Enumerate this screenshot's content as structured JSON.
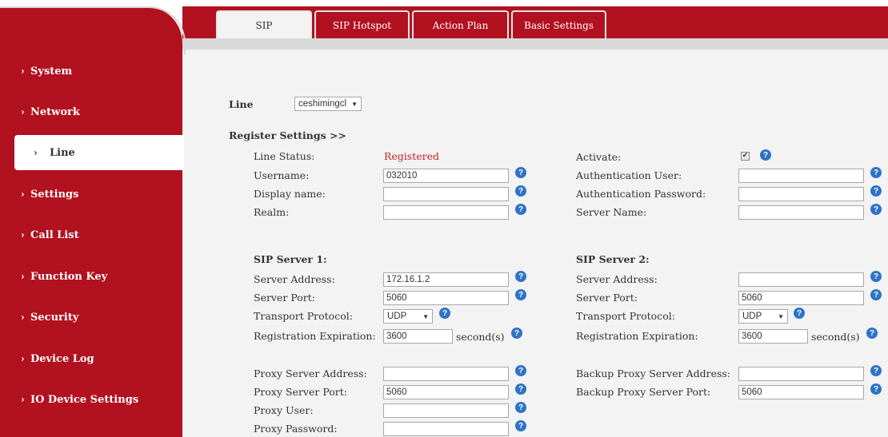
{
  "sidebar": {
    "items": [
      {
        "label": "System"
      },
      {
        "label": "Network"
      },
      {
        "label": "Line"
      },
      {
        "label": "Settings"
      },
      {
        "label": "Call List"
      },
      {
        "label": "Function Key"
      },
      {
        "label": "Security"
      },
      {
        "label": "Device Log"
      },
      {
        "label": "IO Device Settings"
      }
    ],
    "chevron": "›"
  },
  "tabs": [
    {
      "label": "SIP"
    },
    {
      "label": "SIP Hotspot"
    },
    {
      "label": "Action Plan"
    },
    {
      "label": "Basic Settings"
    }
  ],
  "line": {
    "label": "Line",
    "selected": "ceshimingcl"
  },
  "register_settings": {
    "title": "Register Settings >>"
  },
  "fields": {
    "line_status": {
      "label": "Line Status:",
      "value": "Registered"
    },
    "activate": {
      "label": "Activate:",
      "checked": true
    },
    "username": {
      "label": "Username:",
      "value": "032010"
    },
    "auth_user": {
      "label": "Authentication User:",
      "value": ""
    },
    "display_name": {
      "label": "Display name:",
      "value": ""
    },
    "auth_password": {
      "label": "Authentication Password:",
      "value": ""
    },
    "realm": {
      "label": "Realm:",
      "value": ""
    },
    "server_name": {
      "label": "Server Name:",
      "value": ""
    }
  },
  "sip_server_1": {
    "title": "SIP Server 1:",
    "address": {
      "label": "Server Address:",
      "value": "172.16.1.2"
    },
    "port": {
      "label": "Server Port:",
      "value": "5060"
    },
    "transport": {
      "label": "Transport Protocol:",
      "value": "UDP"
    },
    "expiration": {
      "label": "Registration Expiration:",
      "value": "3600",
      "unit": "second(s)"
    }
  },
  "sip_server_2": {
    "title": "SIP Server 2:",
    "address": {
      "label": "Server Address:",
      "value": ""
    },
    "port": {
      "label": "Server Port:",
      "value": "5060"
    },
    "transport": {
      "label": "Transport Protocol:",
      "value": "UDP"
    },
    "expiration": {
      "label": "Registration Expiration:",
      "value": "3600",
      "unit": "second(s)"
    }
  },
  "proxy": {
    "address": {
      "label": "Proxy Server Address:",
      "value": ""
    },
    "port": {
      "label": "Proxy Server Port:",
      "value": "5060"
    },
    "user": {
      "label": "Proxy User:",
      "value": ""
    },
    "password": {
      "label": "Proxy Password:",
      "value": ""
    },
    "backup_address": {
      "label": "Backup Proxy Server Address:",
      "value": ""
    },
    "backup_port": {
      "label": "Backup Proxy Server Port:",
      "value": "5060"
    }
  },
  "icons": {
    "help": "?",
    "dropdown": "▼",
    "check": "✔"
  },
  "colors": {
    "brand": "#b2111f",
    "status_ok": "#c8202a",
    "help": "#2e73c6"
  }
}
